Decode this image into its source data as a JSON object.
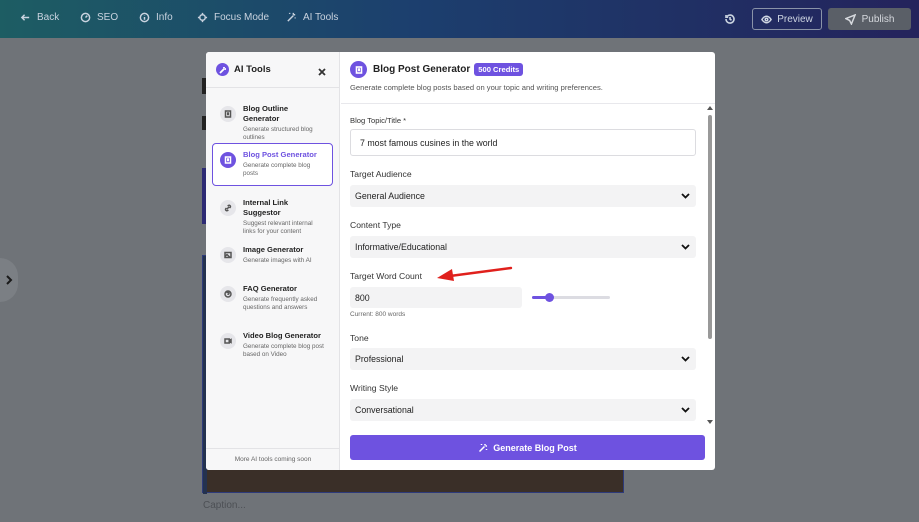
{
  "topbar": {
    "back": "Back",
    "seo": "SEO",
    "info": "Info",
    "focus_mode": "Focus Mode",
    "ai_tools": "AI Tools",
    "preview": "Preview",
    "publish": "Publish"
  },
  "background": {
    "caption_placeholder": "Caption..."
  },
  "sidebar": {
    "title": "AI Tools",
    "tools": [
      {
        "name": "Blog Outline Generator",
        "desc": "Generate structured blog outlines",
        "icon": "document-icon"
      },
      {
        "name": "Blog Post Generator",
        "desc": "Generate complete blog posts",
        "icon": "post-icon",
        "active": true
      },
      {
        "name": "Internal Link Suggestor",
        "desc": "Suggest relevant internal links for your content",
        "icon": "link-icon"
      },
      {
        "name": "Image Generator",
        "desc": "Generate images with AI",
        "icon": "image-icon"
      },
      {
        "name": "FAQ Generator",
        "desc": "Generate frequently asked questions and answers",
        "icon": "question-icon"
      },
      {
        "name": "Video Blog Generator",
        "desc": "Generate complete blog post based on Video",
        "icon": "video-icon"
      }
    ],
    "footer": "More AI tools coming soon"
  },
  "main": {
    "title": "Blog Post Generator",
    "credits": "500 Credits",
    "subtitle": "Generate complete blog posts based on your topic and writing preferences.",
    "topic_label": "Blog Topic/Title *",
    "topic_value": "7 most famous cusines in the world",
    "audience_label": "Target Audience",
    "audience_value": "General Audience",
    "content_type_label": "Content Type",
    "content_type_value": "Informative/Educational",
    "word_count_label": "Target Word Count",
    "word_count_value": "800",
    "word_count_current": "Current: 800 words",
    "word_count_slider_fraction": 0.22,
    "tone_label": "Tone",
    "tone_value": "Professional",
    "style_label": "Writing Style",
    "style_value": "Conversational",
    "generate_button": "Generate Blog Post"
  },
  "colors": {
    "accent": "#6e52e0",
    "annotation_arrow": "#e0201c"
  }
}
